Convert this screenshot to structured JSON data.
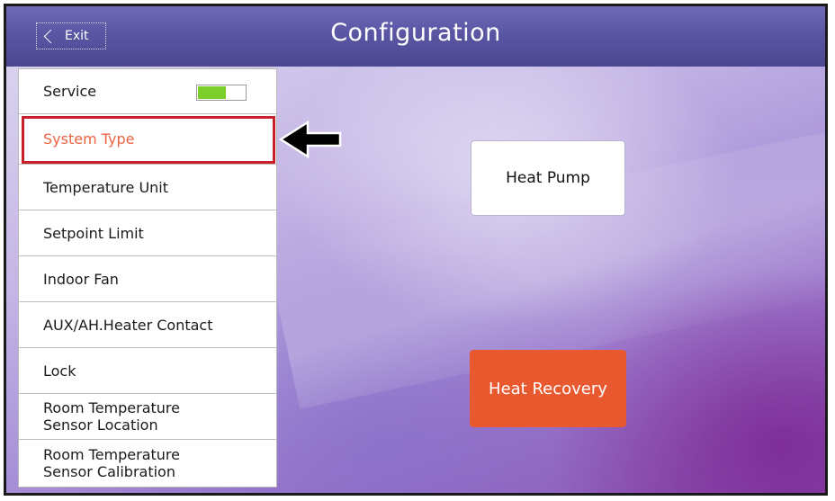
{
  "header": {
    "title": "Configuration",
    "exit_label": "Exit"
  },
  "sidebar": {
    "items": [
      {
        "label": "Service",
        "toggle_on": true
      },
      {
        "label": "System Type",
        "selected": true
      },
      {
        "label": "Temperature Unit"
      },
      {
        "label": "Setpoint Limit"
      },
      {
        "label": "Indoor Fan"
      },
      {
        "label": "AUX/AH.Heater Contact"
      },
      {
        "label": "Lock"
      },
      {
        "label": "Room Temperature\nSensor Location"
      },
      {
        "label": "Room Temperature\nSensor Calibration"
      }
    ]
  },
  "options": {
    "heat_pump_label": "Heat Pump",
    "heat_recovery_label": "Heat Recovery",
    "selected": "Heat Recovery"
  },
  "colors": {
    "accent_orange": "#e9592f",
    "selected_text": "#ee6243",
    "toggle_green": "#7ccf2a",
    "highlight_red": "#c8202a",
    "titlebar": "#5a56a3"
  }
}
